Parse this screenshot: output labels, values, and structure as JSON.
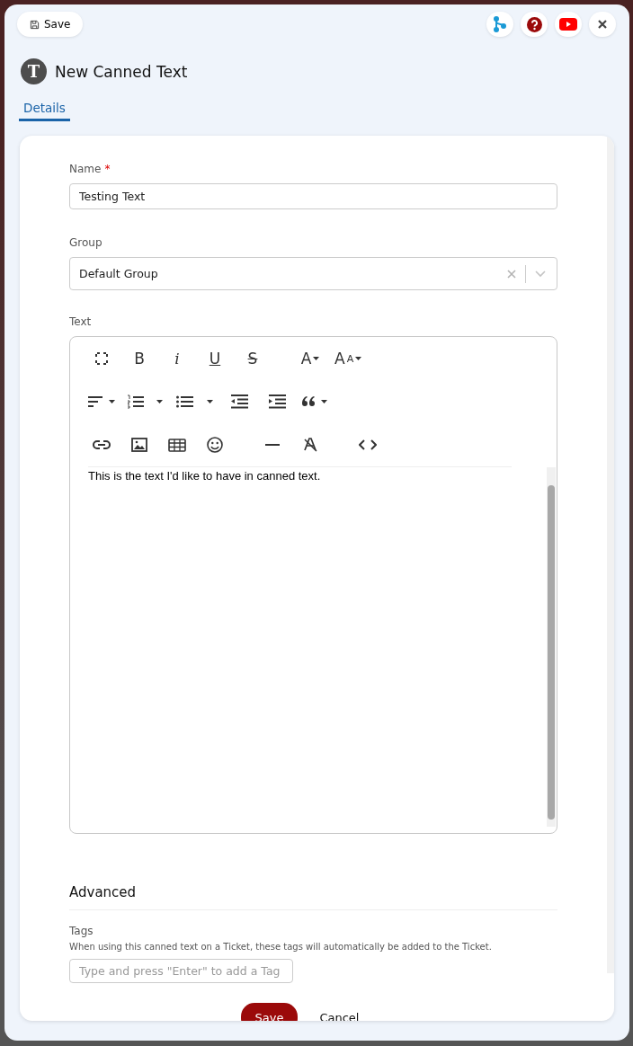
{
  "header": {
    "save_button": "Save",
    "actions": [
      {
        "kind": "branch"
      },
      {
        "kind": "help"
      },
      {
        "kind": "video"
      },
      {
        "kind": "close"
      }
    ]
  },
  "title": {
    "avatar": "T",
    "text": "New Canned Text"
  },
  "tabs": [
    {
      "label": "Details",
      "selected": true
    }
  ],
  "form": {
    "name": {
      "label": "Name",
      "required": true,
      "required_mark": "*",
      "value": "Testing Text"
    },
    "group": {
      "label": "Group",
      "value": "Default Group"
    },
    "text": {
      "label": "Text",
      "toolbar": [
        [
          {
            "kind": "fullscreen"
          },
          {
            "kind": "bold",
            "label": "B"
          },
          {
            "kind": "italic",
            "label": "i"
          },
          {
            "kind": "underline",
            "label": "U"
          },
          {
            "kind": "strike",
            "label": "S"
          },
          {
            "kind": "gap"
          },
          {
            "kind": "color",
            "label": "A"
          },
          {
            "kind": "size",
            "label": "A",
            "small": "A"
          }
        ],
        [
          {
            "kind": "align"
          },
          {
            "kind": "ordered"
          },
          {
            "kind": "bullets"
          },
          {
            "kind": "outdent"
          },
          {
            "kind": "indent"
          },
          {
            "kind": "quote"
          }
        ],
        [
          {
            "kind": "link"
          },
          {
            "kind": "image"
          },
          {
            "kind": "table"
          },
          {
            "kind": "emoji"
          },
          {
            "kind": "gap"
          },
          {
            "kind": "rule"
          },
          {
            "kind": "clear"
          },
          {
            "kind": "gap"
          },
          {
            "kind": "code"
          }
        ]
      ],
      "content": "This is the text I'd like to have in canned text."
    },
    "advanced": {
      "heading": "Advanced",
      "tags_label": "Tags",
      "tags_help": "When using this canned text on a Ticket, these tags will automatically be added to the Ticket.",
      "tags_placeholder": "Type and press \"Enter\" to add a Tag"
    }
  },
  "footer": {
    "save": "Save",
    "cancel": "Cancel"
  }
}
